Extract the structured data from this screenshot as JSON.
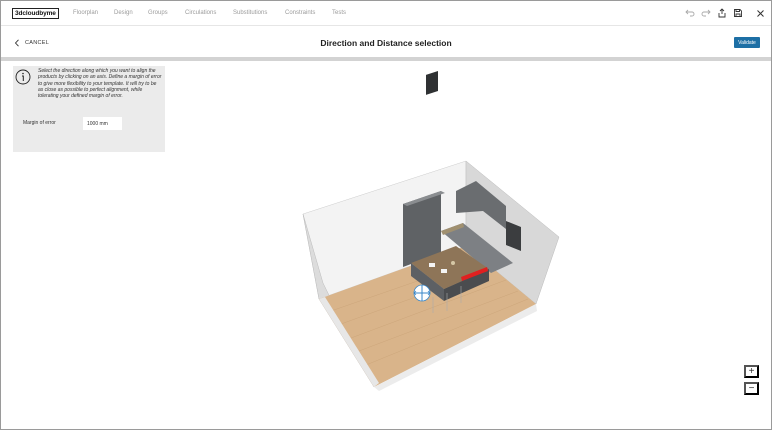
{
  "app": {
    "logo_text": "3dcloudbyme",
    "nav": [
      {
        "label": "Floorplan"
      },
      {
        "label": "Design"
      },
      {
        "label": "Groups"
      },
      {
        "label": "Circulations"
      },
      {
        "label": "Substitutions"
      },
      {
        "label": "Constraints"
      },
      {
        "label": "Tests"
      }
    ],
    "toolbar_icons": [
      "undo-icon",
      "redo-icon",
      "share-icon",
      "save-icon",
      "close-icon"
    ]
  },
  "header": {
    "cancel_label": "CANCEL",
    "title": "Direction and Distance selection",
    "validate_label": "Validate"
  },
  "info_panel": {
    "text": "Select the direction along which you want to align the products by clicking on an axis. Define a margin of error to give more flexibility to your template. It will try to be as close as possible to perfect alignment, while tolerating your defined margin of error.",
    "margin_label": "Margin of error",
    "margin_value": "1000 mm"
  },
  "zoom": {
    "plus": "+",
    "minus": "−"
  },
  "colors": {
    "accent": "#1d6fa5",
    "axis_highlight": "#e02020",
    "axis_selector": "#3a87c8"
  }
}
